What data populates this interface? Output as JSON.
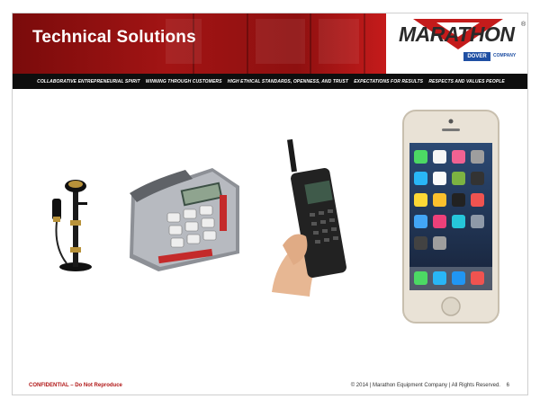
{
  "header": {
    "title": "Technical Solutions",
    "logo_text": "MARATHON",
    "logo_reg": "®",
    "dover_badge": "DOVER",
    "dover_company": "COMPANY",
    "brand_color": "#a21414"
  },
  "tagline": {
    "items": [
      "COLLABORATIVE ENTREPRENEURIAL SPIRIT",
      "WINNING THROUGH CUSTOMERS",
      "HIGH ETHICAL STANDARDS, OPENNESS, AND TRUST",
      "EXPECTATIONS FOR RESULTS",
      "RESPECTS AND VALUES PEOPLE"
    ]
  },
  "images": [
    {
      "name": "candlestick-telephone-image"
    },
    {
      "name": "desk-phone-image"
    },
    {
      "name": "brick-mobile-phone-image"
    },
    {
      "name": "smartphone-image"
    }
  ],
  "footer": {
    "confidential": "CONFIDENTIAL – Do Not Reproduce",
    "copyright": "© 2014 | Marathon Equipment Company | All Rights Reserved.",
    "page_number": "6"
  }
}
